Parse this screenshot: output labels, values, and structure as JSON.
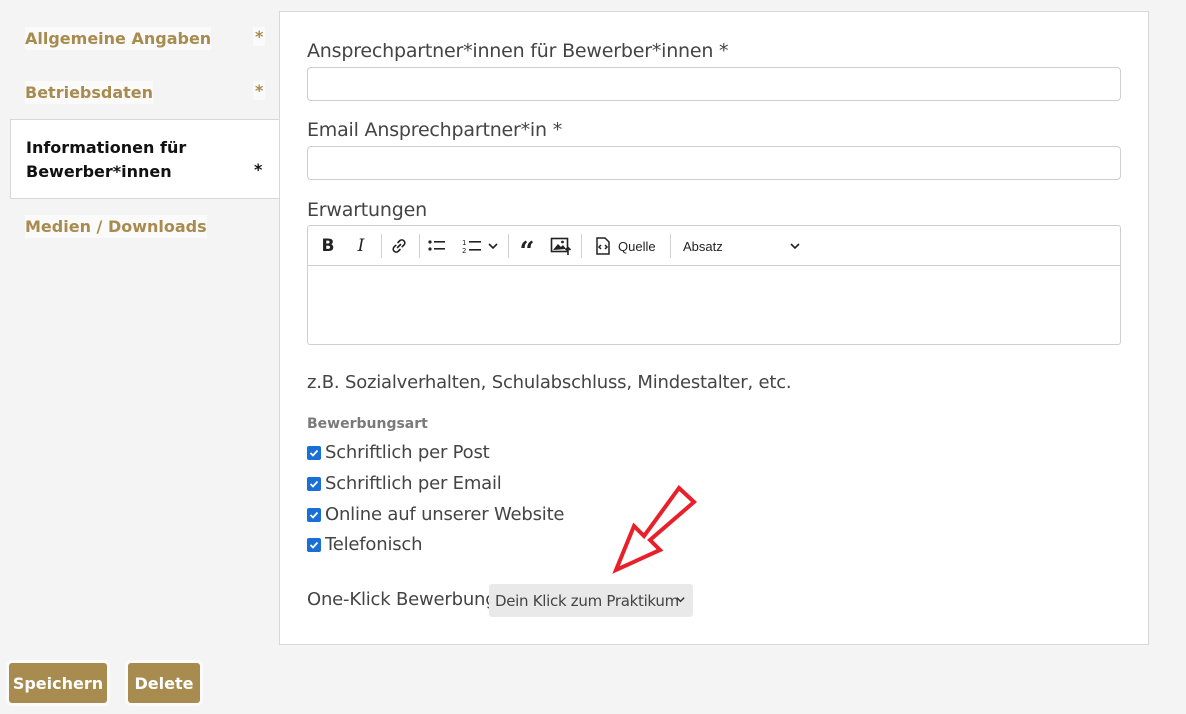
{
  "sidebar": {
    "items": [
      {
        "label": "Allgemeine Angaben",
        "required": "*"
      },
      {
        "label": "Betriebsdaten",
        "required": "*"
      },
      {
        "label": "Informationen für Bewerber*innen",
        "required": "*"
      },
      {
        "label": "Medien / Downloads",
        "required": ""
      }
    ]
  },
  "form": {
    "contact_label": "Ansprechpartner*innen für Bewerber*innen *",
    "contact_value": "",
    "email_label": "Email Ansprechpartner*in *",
    "email_value": "",
    "expectations_label": "Erwartungen",
    "editor": {
      "source_label": "Quelle",
      "paragraph_label": "Absatz",
      "content": ""
    },
    "hint": "z.B. Sozialverhalten, Schulabschluss, Mindestalter, etc.",
    "application_type_label": "Bewerbungsart",
    "application_types": [
      {
        "label": "Schriftlich per Post",
        "checked": true
      },
      {
        "label": "Schriftlich per Email",
        "checked": true
      },
      {
        "label": "Online auf unserer Website",
        "checked": true
      },
      {
        "label": "Telefonisch",
        "checked": true
      }
    ],
    "one_klick_label": "One-Klick Bewerbung",
    "one_klick_selected": "Dein Klick zum Praktikum"
  },
  "actions": {
    "save_label": "Speichern",
    "delete_label": "Delete"
  },
  "colors": {
    "accent": "#a88b4f",
    "checkbox": "#1a6fd6",
    "annotation_arrow": "#e8202a"
  }
}
